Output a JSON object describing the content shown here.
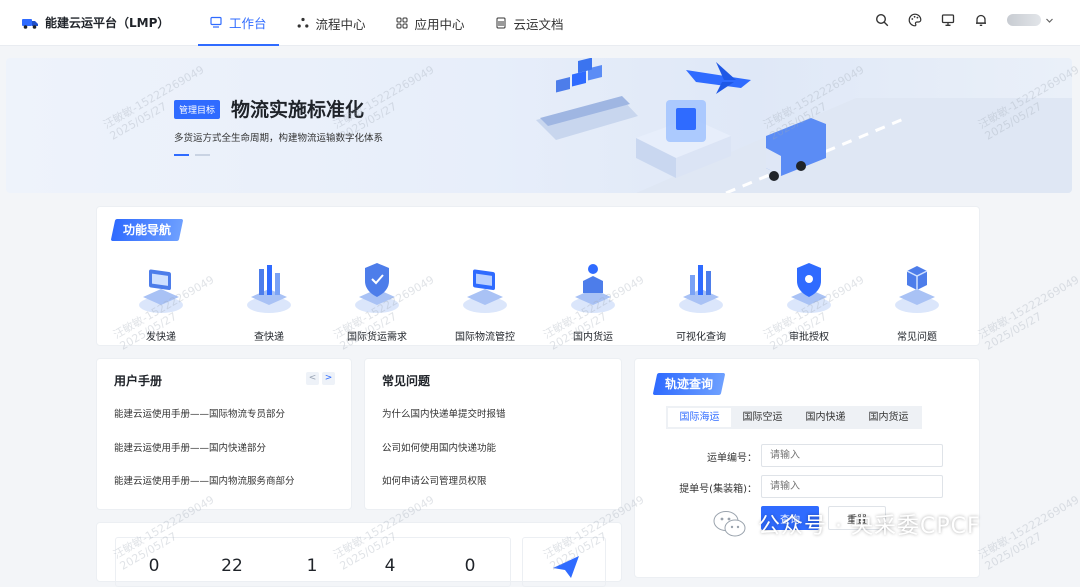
{
  "header": {
    "title": "能建云运平台（LMP）",
    "nav": [
      {
        "label": "工作台",
        "active": true
      },
      {
        "label": "流程中心",
        "active": false
      },
      {
        "label": "应用中心",
        "active": false
      },
      {
        "label": "云运文档",
        "active": false
      }
    ]
  },
  "banner": {
    "tag": "管理目标",
    "title": "物流实施标准化",
    "subtitle": "多货运方式全生命周期，构建物流运输数字化体系"
  },
  "function_nav": {
    "title": "功能导航",
    "items": [
      "发快递",
      "查快递",
      "国际货运需求",
      "国际物流管控",
      "国内货运",
      "可视化查询",
      "审批授权",
      "常见问题"
    ]
  },
  "manual": {
    "title": "用户手册",
    "prev": "<",
    "next": ">",
    "items": [
      "能建云运使用手册——国际物流专员部分",
      "能建云运使用手册——国内快递部分",
      "能建云运使用手册——国内物流服务商部分"
    ]
  },
  "faq": {
    "title": "常见问题",
    "items": [
      "为什么国内快递单提交时报错",
      "公司如何使用国内快递功能",
      "如何申请公司管理员权限"
    ]
  },
  "tracking": {
    "title": "轨迹查询",
    "tabs": [
      "国际海运",
      "国际空运",
      "国内快递",
      "国内货运"
    ],
    "waybill_label": "运单编号：",
    "waybill_placeholder": "请输入",
    "bl_label": "提单号(集装箱)：",
    "bl_placeholder": "请输入",
    "query_button": "查询",
    "reset_button": "重置"
  },
  "stats": {
    "values": [
      "0",
      "22",
      "1",
      "4",
      "0"
    ]
  },
  "watermark": {
    "line1": "汪敏敏-15222269049",
    "line2": "2025/05/27"
  },
  "overlay": {
    "wechat_text": "公众号 · 央采委CPCF"
  },
  "colors": {
    "accent": "#2f6bff"
  }
}
